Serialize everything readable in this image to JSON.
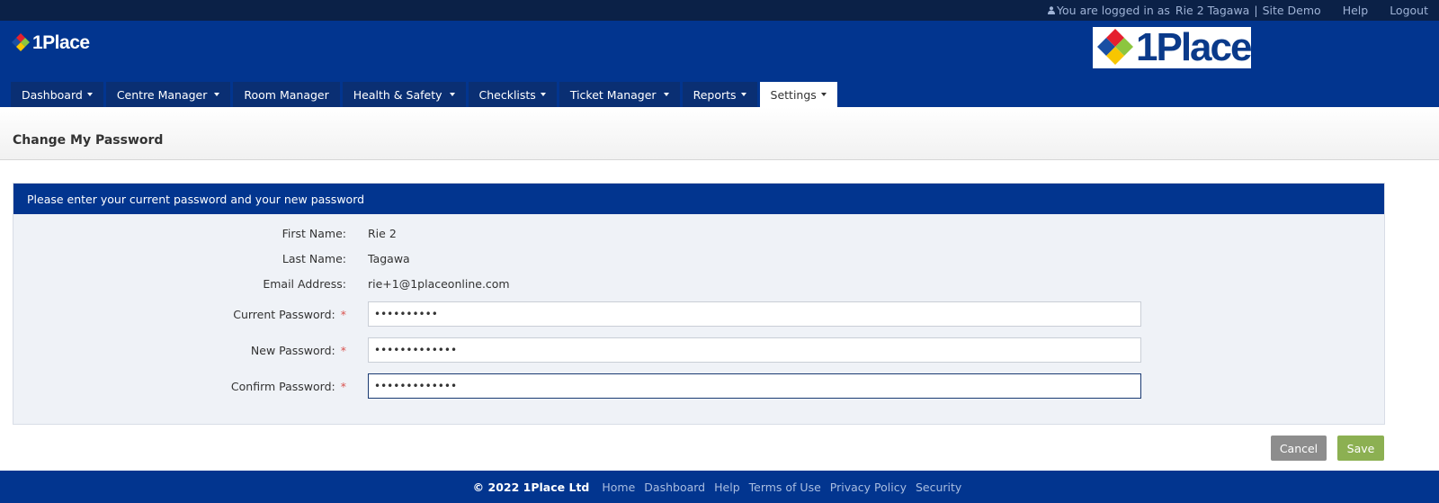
{
  "topbar": {
    "login_text": "You are logged in as",
    "user_name": "Rie 2 Tagawa",
    "separator": "|",
    "site": "Site Demo",
    "help": "Help",
    "logout": "Logout"
  },
  "brand": {
    "logo_text": "1Place",
    "colors": {
      "red": "#e5202e",
      "blue": "#1a4fa3",
      "green": "#8cc63f",
      "yellow": "#f7c600"
    }
  },
  "nav": {
    "items": [
      {
        "label": "Dashboard",
        "dropdown": true
      },
      {
        "label": "Centre Manager",
        "dropdown": true
      },
      {
        "label": "Room Manager",
        "dropdown": false
      },
      {
        "label": "Health & Safety",
        "dropdown": true
      },
      {
        "label": "Checklists",
        "dropdown": true
      },
      {
        "label": "Ticket Manager",
        "dropdown": true
      },
      {
        "label": "Reports",
        "dropdown": true
      },
      {
        "label": "Settings",
        "dropdown": true,
        "active": true
      }
    ]
  },
  "page": {
    "title": "Change My Password"
  },
  "form": {
    "heading": "Please enter your current password and your new password",
    "first_name_label": "First Name:",
    "first_name": "Rie 2",
    "last_name_label": "Last Name:",
    "last_name": "Tagawa",
    "email_label": "Email Address:",
    "email": "rie+1@1placeonline.com",
    "current_password_label": "Current Password:",
    "current_password": "••••••••••",
    "new_password_label": "New Password:",
    "new_password": "•••••••••••••",
    "confirm_password_label": "Confirm Password:",
    "confirm_password": "•••••••••••••",
    "required_marker": "*"
  },
  "actions": {
    "cancel": "Cancel",
    "save": "Save"
  },
  "footer": {
    "copyright": "© 2022 1Place Ltd",
    "links": [
      "Home",
      "Dashboard",
      "Help",
      "Terms of Use",
      "Privacy Policy",
      "Security"
    ]
  }
}
